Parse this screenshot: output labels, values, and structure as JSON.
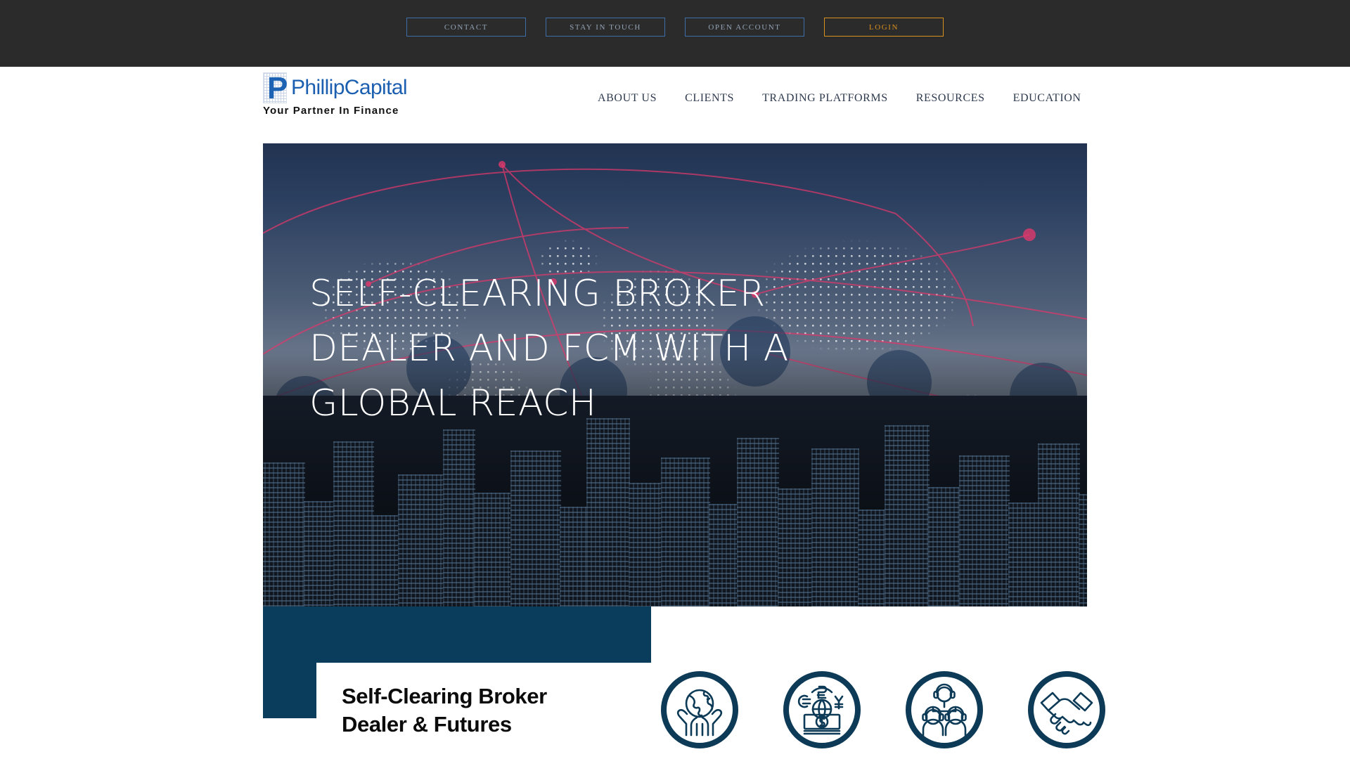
{
  "topbar": {
    "background": "#2b2b2b",
    "buttons": [
      {
        "label": "CONTACT",
        "name": "contact-button",
        "style": "blue"
      },
      {
        "label": "STAY IN TOUCH",
        "name": "stay-in-touch-button",
        "style": "blue"
      },
      {
        "label": "OPEN ACCOUNT",
        "name": "open-account-button",
        "style": "blue"
      },
      {
        "label": "LOGIN",
        "name": "login-button",
        "style": "gold"
      }
    ],
    "blue_border": "#3f6da8",
    "blue_text": "#93a3b5",
    "gold": "#d8901f"
  },
  "header": {
    "logo": {
      "mark_letter": "P",
      "wordmark": "PhillipCapital",
      "tagline": "Your Partner In Finance",
      "wordmark_color": "#1c5fb0"
    },
    "nav": [
      {
        "label": "ABOUT US"
      },
      {
        "label": "CLIENTS"
      },
      {
        "label": "TRADING PLATFORMS"
      },
      {
        "label": "RESOURCES"
      },
      {
        "label": "EDUCATION"
      }
    ]
  },
  "hero": {
    "headline": "Self-Clearing Broker Dealer and FCM with a Global Reach",
    "headline_color": "#ffffff"
  },
  "promo": {
    "accent_color": "#0a3d5c",
    "title": "Self-Clearing Broker Dealer & Futures",
    "icons": [
      {
        "name": "globe-in-hands-icon",
        "label": "global reach"
      },
      {
        "name": "currency-money-icon",
        "label": "multi currency"
      },
      {
        "name": "support-team-icon",
        "label": "support team"
      },
      {
        "name": "handshake-icon",
        "label": "partnership"
      }
    ],
    "icon_color": "#0d3a56"
  }
}
